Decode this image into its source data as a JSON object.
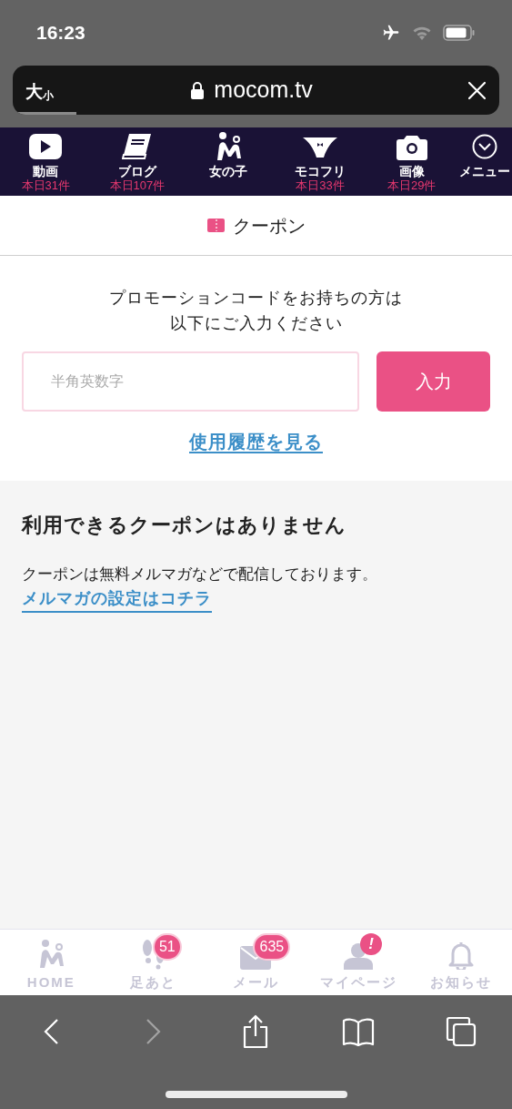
{
  "status_bar": {
    "time": "16:23"
  },
  "browser": {
    "text_size": "大",
    "text_size_small": "小",
    "url": "mocom.tv",
    "load": {
      "level": 0.13
    }
  },
  "nav": [
    {
      "kind": "video",
      "label": "動画",
      "count": "本日31件"
    },
    {
      "kind": "blog",
      "label": "ブログ",
      "count": "本日107件"
    },
    {
      "kind": "girls",
      "label": "女の子"
    },
    {
      "kind": "briefs",
      "label": "モコフリ",
      "count": "本日33件"
    },
    {
      "kind": "camera",
      "label": "画像",
      "count": "本日29件"
    },
    {
      "kind": "menu",
      "label": "メニュー"
    }
  ],
  "page_title": "クーポン",
  "promo": {
    "prompt_line_1": "プロモーションコードをお持ちの方は",
    "prompt_line_2": "以下にご入力ください",
    "placeholder": "半角英数字",
    "submit": "入力",
    "history_link": "使用履歴を見る"
  },
  "coupons": {
    "heading": "利用できるクーポンはありません",
    "note": "クーポンは無料メルマガなどで配信しております。",
    "settings_link": "メルマガの設定はコチラ"
  },
  "tabs": [
    {
      "kind": "home",
      "label": "HOME"
    },
    {
      "kind": "footprints",
      "label": "足あと",
      "badge": "51"
    },
    {
      "kind": "mail",
      "label": "メール",
      "badge": "635"
    },
    {
      "kind": "mypage",
      "label": "マイページ",
      "badge": "!"
    },
    {
      "kind": "bell",
      "label": "お知らせ"
    }
  ],
  "toolbar": [
    {
      "kind": "back",
      "disabled": false
    },
    {
      "kind": "forward",
      "disabled": true
    },
    {
      "kind": "share",
      "disabled": false
    },
    {
      "kind": "bookmarks",
      "disabled": false
    },
    {
      "kind": "tabs",
      "disabled": false
    }
  ]
}
